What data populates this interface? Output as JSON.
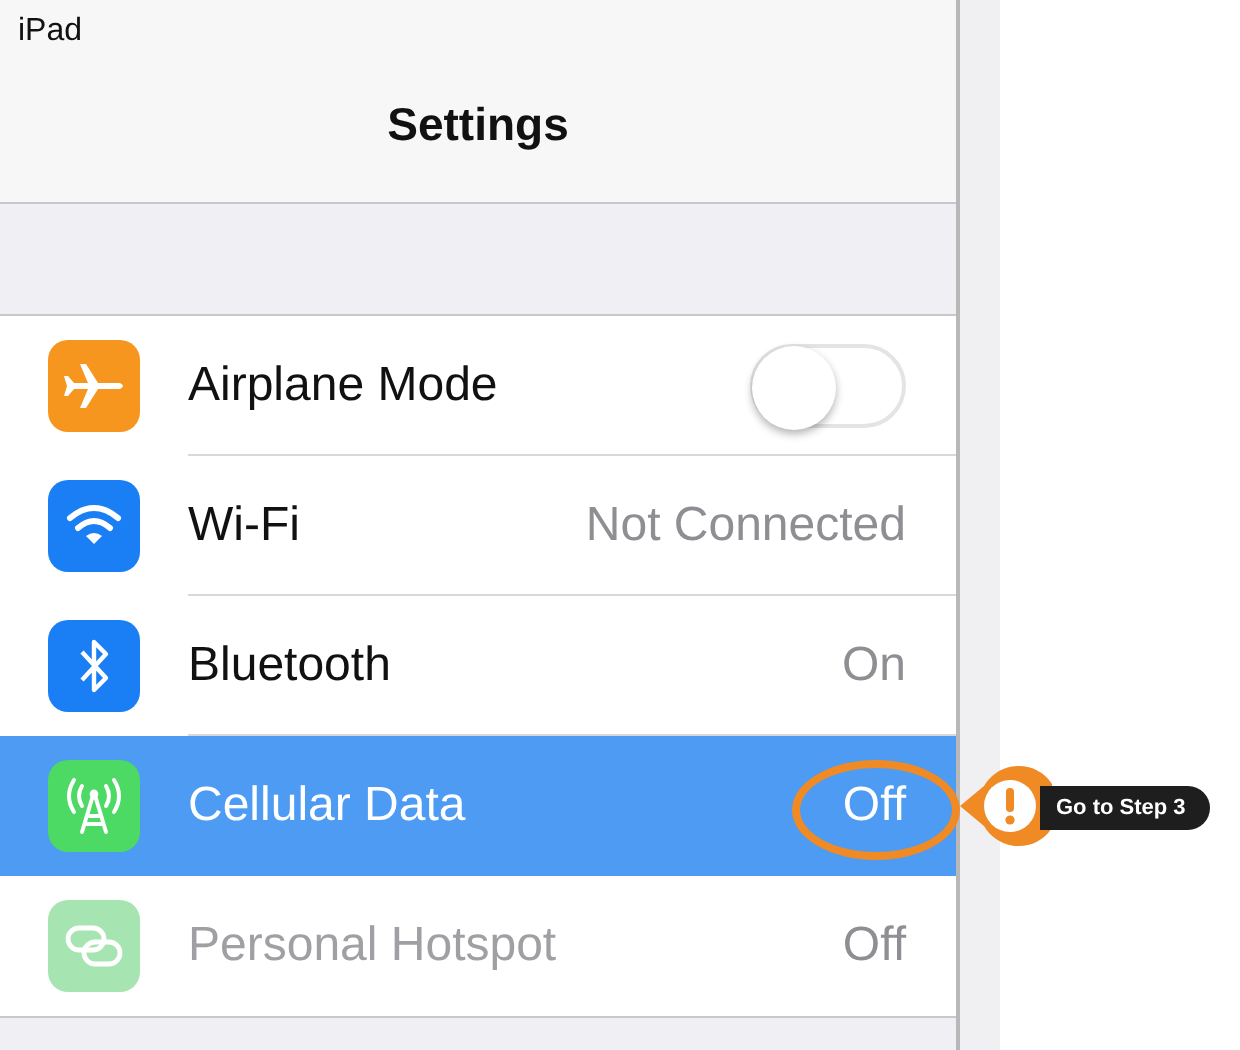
{
  "status_bar": {
    "device": "iPad"
  },
  "header": {
    "title": "Settings"
  },
  "items": [
    {
      "label": "Airplane Mode",
      "color": "#f7961e",
      "kind": "toggle",
      "on": false,
      "selected": false,
      "disabled": false
    },
    {
      "label": "Wi-Fi",
      "color": "#1a7ff5",
      "kind": "value",
      "value": "Not Connected",
      "selected": false,
      "disabled": false
    },
    {
      "label": "Bluetooth",
      "color": "#1a7ff5",
      "kind": "value",
      "value": "On",
      "selected": false,
      "disabled": false
    },
    {
      "label": "Cellular Data",
      "color": "#4cd964",
      "kind": "value",
      "value": "Off",
      "selected": true,
      "disabled": false,
      "callout": {
        "label": "Go to Step 3"
      }
    },
    {
      "label": "Personal Hotspot",
      "color": "#a6e4b2",
      "kind": "value",
      "value": "Off",
      "selected": false,
      "disabled": true
    }
  ]
}
